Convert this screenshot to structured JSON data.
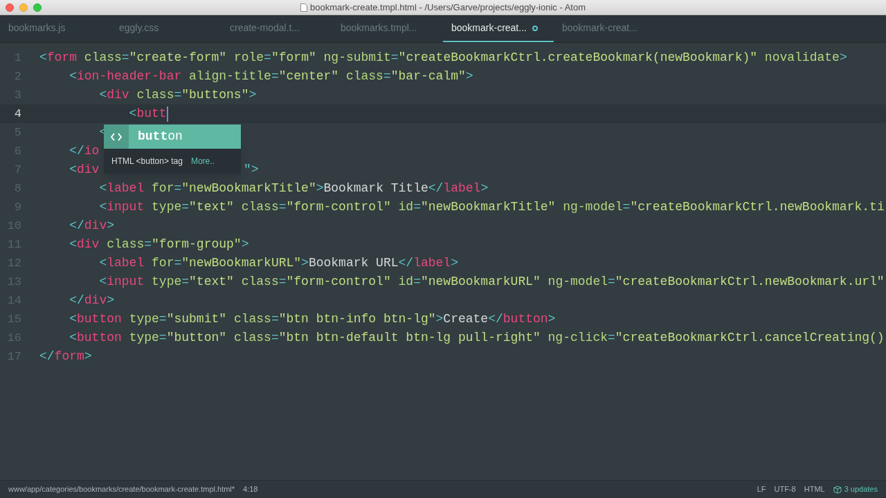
{
  "window": {
    "title": "bookmark-create.tmpl.html - /Users/Garve/projects/eggly-ionic - Atom"
  },
  "tabs": [
    {
      "label": "bookmarks.js",
      "selected": false,
      "modified": false
    },
    {
      "label": "eggly.css",
      "selected": false,
      "modified": false
    },
    {
      "label": "create-modal.t...",
      "selected": false,
      "modified": false
    },
    {
      "label": "bookmarks.tmpl...",
      "selected": false,
      "modified": false
    },
    {
      "label": "bookmark-creat...",
      "selected": true,
      "modified": true
    },
    {
      "label": "bookmark-creat...",
      "selected": false,
      "modified": false
    }
  ],
  "editor": {
    "lines": [
      {
        "number": "1",
        "current": false,
        "tokens": [
          {
            "kind": "punct",
            "text": "<"
          },
          {
            "kind": "tag",
            "text": "form"
          },
          {
            "kind": "attr",
            "text": " class"
          },
          {
            "kind": "punct",
            "text": "="
          },
          {
            "kind": "string",
            "text": "\"create-form\""
          },
          {
            "kind": "attr",
            "text": " role"
          },
          {
            "kind": "punct",
            "text": "="
          },
          {
            "kind": "string",
            "text": "\"form\""
          },
          {
            "kind": "attr",
            "text": " ng-submit"
          },
          {
            "kind": "punct",
            "text": "="
          },
          {
            "kind": "string",
            "text": "\"createBookmarkCtrl.createBookmark(newBookmark)\""
          },
          {
            "kind": "attr",
            "text": " novalidate"
          },
          {
            "kind": "punct",
            "text": ">"
          }
        ]
      },
      {
        "number": "2",
        "current": false,
        "tokens": [
          {
            "kind": "punct",
            "text": "    <"
          },
          {
            "kind": "tag",
            "text": "ion-header-bar"
          },
          {
            "kind": "attr",
            "text": " align-title"
          },
          {
            "kind": "punct",
            "text": "="
          },
          {
            "kind": "string",
            "text": "\"center\""
          },
          {
            "kind": "attr",
            "text": " class"
          },
          {
            "kind": "punct",
            "text": "="
          },
          {
            "kind": "string",
            "text": "\"bar-calm\""
          },
          {
            "kind": "punct",
            "text": ">"
          }
        ]
      },
      {
        "number": "3",
        "current": false,
        "tokens": [
          {
            "kind": "punct",
            "text": "        <"
          },
          {
            "kind": "tag",
            "text": "div"
          },
          {
            "kind": "attr",
            "text": " class"
          },
          {
            "kind": "punct",
            "text": "="
          },
          {
            "kind": "string",
            "text": "\"buttons\""
          },
          {
            "kind": "punct",
            "text": ">"
          }
        ]
      },
      {
        "number": "4",
        "current": true,
        "cursor": true,
        "tokens": [
          {
            "kind": "punct",
            "text": "            <"
          },
          {
            "kind": "tag",
            "text": "butt"
          }
        ]
      },
      {
        "number": "5",
        "current": false,
        "tokens": [
          {
            "kind": "punct",
            "text": "        <"
          }
        ]
      },
      {
        "number": "6",
        "current": false,
        "tokens": [
          {
            "kind": "punct",
            "text": "    </"
          },
          {
            "kind": "tag",
            "text": "io"
          }
        ]
      },
      {
        "number": "7",
        "current": false,
        "tokens": [
          {
            "kind": "punct",
            "text": "    <"
          },
          {
            "kind": "tag",
            "text": "div"
          }
        ],
        "after_popup": [
          {
            "kind": "punct",
            "text": "\">"
          }
        ]
      },
      {
        "number": "8",
        "current": false,
        "tokens": [
          {
            "kind": "punct",
            "text": "        <"
          },
          {
            "kind": "tag",
            "text": "label"
          },
          {
            "kind": "attr",
            "text": " for"
          },
          {
            "kind": "punct",
            "text": "="
          },
          {
            "kind": "string",
            "text": "\"newBookmarkTitle\""
          },
          {
            "kind": "punct",
            "text": ">"
          },
          {
            "kind": "text",
            "text": "Bookmark Title"
          },
          {
            "kind": "punct",
            "text": "</"
          },
          {
            "kind": "tag",
            "text": "label"
          },
          {
            "kind": "punct",
            "text": ">"
          }
        ]
      },
      {
        "number": "9",
        "current": false,
        "tokens": [
          {
            "kind": "punct",
            "text": "        <"
          },
          {
            "kind": "tag",
            "text": "input"
          },
          {
            "kind": "attr",
            "text": " type"
          },
          {
            "kind": "punct",
            "text": "="
          },
          {
            "kind": "string",
            "text": "\"text\""
          },
          {
            "kind": "attr",
            "text": " class"
          },
          {
            "kind": "punct",
            "text": "="
          },
          {
            "kind": "string",
            "text": "\"form-control\""
          },
          {
            "kind": "attr",
            "text": " id"
          },
          {
            "kind": "punct",
            "text": "="
          },
          {
            "kind": "string",
            "text": "\"newBookmarkTitle\""
          },
          {
            "kind": "attr",
            "text": " ng-model"
          },
          {
            "kind": "punct",
            "text": "="
          },
          {
            "kind": "string",
            "text": "\"createBookmarkCtrl.newBookmark.ti"
          }
        ]
      },
      {
        "number": "10",
        "current": false,
        "tokens": [
          {
            "kind": "punct",
            "text": "    </"
          },
          {
            "kind": "tag",
            "text": "div"
          },
          {
            "kind": "punct",
            "text": ">"
          }
        ]
      },
      {
        "number": "11",
        "current": false,
        "tokens": [
          {
            "kind": "punct",
            "text": "    <"
          },
          {
            "kind": "tag",
            "text": "div"
          },
          {
            "kind": "attr",
            "text": " class"
          },
          {
            "kind": "punct",
            "text": "="
          },
          {
            "kind": "string",
            "text": "\"form-group\""
          },
          {
            "kind": "punct",
            "text": ">"
          }
        ]
      },
      {
        "number": "12",
        "current": false,
        "tokens": [
          {
            "kind": "punct",
            "text": "        <"
          },
          {
            "kind": "tag",
            "text": "label"
          },
          {
            "kind": "attr",
            "text": " for"
          },
          {
            "kind": "punct",
            "text": "="
          },
          {
            "kind": "string",
            "text": "\"newBookmarkURL\""
          },
          {
            "kind": "punct",
            "text": ">"
          },
          {
            "kind": "text",
            "text": "Bookmark URL"
          },
          {
            "kind": "punct",
            "text": "</"
          },
          {
            "kind": "tag",
            "text": "label"
          },
          {
            "kind": "punct",
            "text": ">"
          }
        ]
      },
      {
        "number": "13",
        "current": false,
        "tokens": [
          {
            "kind": "punct",
            "text": "        <"
          },
          {
            "kind": "tag",
            "text": "input"
          },
          {
            "kind": "attr",
            "text": " type"
          },
          {
            "kind": "punct",
            "text": "="
          },
          {
            "kind": "string",
            "text": "\"text\""
          },
          {
            "kind": "attr",
            "text": " class"
          },
          {
            "kind": "punct",
            "text": "="
          },
          {
            "kind": "string",
            "text": "\"form-control\""
          },
          {
            "kind": "attr",
            "text": " id"
          },
          {
            "kind": "punct",
            "text": "="
          },
          {
            "kind": "string",
            "text": "\"newBookmarkURL\""
          },
          {
            "kind": "attr",
            "text": " ng-model"
          },
          {
            "kind": "punct",
            "text": "="
          },
          {
            "kind": "string",
            "text": "\"createBookmarkCtrl.newBookmark.url\""
          }
        ]
      },
      {
        "number": "14",
        "current": false,
        "tokens": [
          {
            "kind": "punct",
            "text": "    </"
          },
          {
            "kind": "tag",
            "text": "div"
          },
          {
            "kind": "punct",
            "text": ">"
          }
        ]
      },
      {
        "number": "15",
        "current": false,
        "tokens": [
          {
            "kind": "punct",
            "text": "    <"
          },
          {
            "kind": "tag",
            "text": "button"
          },
          {
            "kind": "attr",
            "text": " type"
          },
          {
            "kind": "punct",
            "text": "="
          },
          {
            "kind": "string",
            "text": "\"submit\""
          },
          {
            "kind": "attr",
            "text": " class"
          },
          {
            "kind": "punct",
            "text": "="
          },
          {
            "kind": "string",
            "text": "\"btn btn-info btn-lg\""
          },
          {
            "kind": "punct",
            "text": ">"
          },
          {
            "kind": "text",
            "text": "Create"
          },
          {
            "kind": "punct",
            "text": "</"
          },
          {
            "kind": "tag",
            "text": "button"
          },
          {
            "kind": "punct",
            "text": ">"
          }
        ]
      },
      {
        "number": "16",
        "current": false,
        "tokens": [
          {
            "kind": "punct",
            "text": "    <"
          },
          {
            "kind": "tag",
            "text": "button"
          },
          {
            "kind": "attr",
            "text": " type"
          },
          {
            "kind": "punct",
            "text": "="
          },
          {
            "kind": "string",
            "text": "\"button\""
          },
          {
            "kind": "attr",
            "text": " class"
          },
          {
            "kind": "punct",
            "text": "="
          },
          {
            "kind": "string",
            "text": "\"btn btn-default btn-lg pull-right\""
          },
          {
            "kind": "attr",
            "text": " ng-click"
          },
          {
            "kind": "punct",
            "text": "="
          },
          {
            "kind": "string",
            "text": "\"createBookmarkCtrl.cancelCreating()"
          }
        ]
      },
      {
        "number": "17",
        "current": false,
        "tokens": [
          {
            "kind": "punct",
            "text": "</"
          },
          {
            "kind": "tag",
            "text": "form"
          },
          {
            "kind": "punct",
            "text": ">"
          }
        ]
      }
    ]
  },
  "autocomplete": {
    "suggestion": "**butt**on",
    "description": "HTML <button> tag",
    "more_link": "More.."
  },
  "status_bar": {
    "path": "www/app/categories/bookmarks/create/bookmark-create.tmpl.html*",
    "position": "4:18",
    "line_ending": "LF",
    "encoding": "UTF-8",
    "grammar": "HTML",
    "updates": "3 updates"
  }
}
